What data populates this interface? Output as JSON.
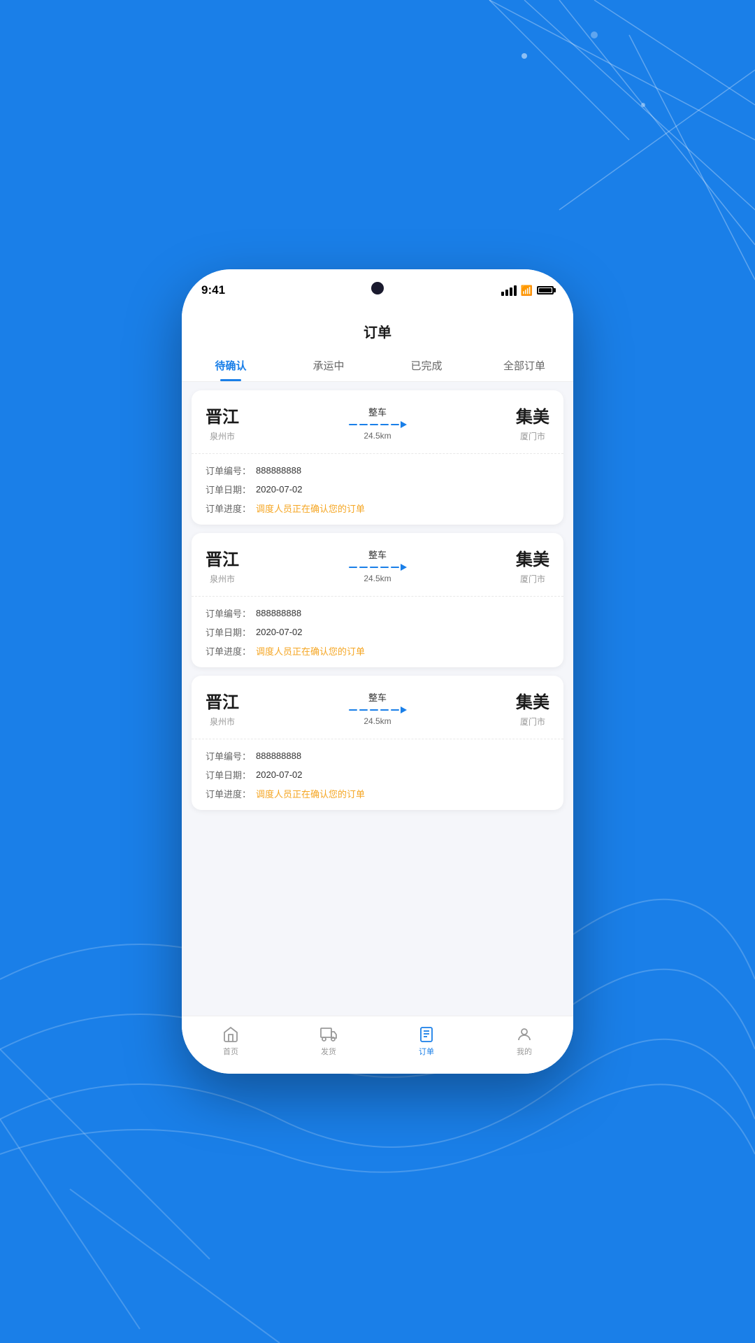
{
  "background": {
    "color": "#1a7fe8"
  },
  "status_bar": {
    "time": "9:41"
  },
  "page": {
    "title": "订单"
  },
  "tabs": [
    {
      "id": "pending",
      "label": "待确认",
      "active": true
    },
    {
      "id": "shipping",
      "label": "承运中",
      "active": false
    },
    {
      "id": "completed",
      "label": "已完成",
      "active": false
    },
    {
      "id": "all",
      "label": "全部订单",
      "active": false
    }
  ],
  "orders": [
    {
      "from_city": "晋江",
      "from_sub": "泉州市",
      "to_city": "集美",
      "to_sub": "厦门市",
      "route_type": "整车",
      "distance": "24.5km",
      "order_no_label": "订单编号：",
      "order_no": "888888888",
      "order_date_label": "订单日期：",
      "order_date": "2020-07-02",
      "order_progress_label": "订单进度：",
      "order_progress": "调度人员正在确认您的订单"
    },
    {
      "from_city": "晋江",
      "from_sub": "泉州市",
      "to_city": "集美",
      "to_sub": "厦门市",
      "route_type": "整车",
      "distance": "24.5km",
      "order_no_label": "订单编号：",
      "order_no": "888888888",
      "order_date_label": "订单日期：",
      "order_date": "2020-07-02",
      "order_progress_label": "订单进度：",
      "order_progress": "调度人员正在确认您的订单"
    },
    {
      "from_city": "晋江",
      "from_sub": "泉州市",
      "to_city": "集美",
      "to_sub": "厦门市",
      "route_type": "整车",
      "distance": "24.5km",
      "order_no_label": "订单编号：",
      "order_no": "888888888",
      "order_date_label": "订单日期：",
      "order_date": "2020-07-02",
      "order_progress_label": "订单进度：",
      "order_progress": "调度人员正在确认您的订单"
    }
  ],
  "bottom_nav": [
    {
      "id": "home",
      "label": "首页",
      "active": false
    },
    {
      "id": "shipping",
      "label": "发货",
      "active": false
    },
    {
      "id": "order",
      "label": "订单",
      "active": true
    },
    {
      "id": "profile",
      "label": "我的",
      "active": false
    }
  ]
}
